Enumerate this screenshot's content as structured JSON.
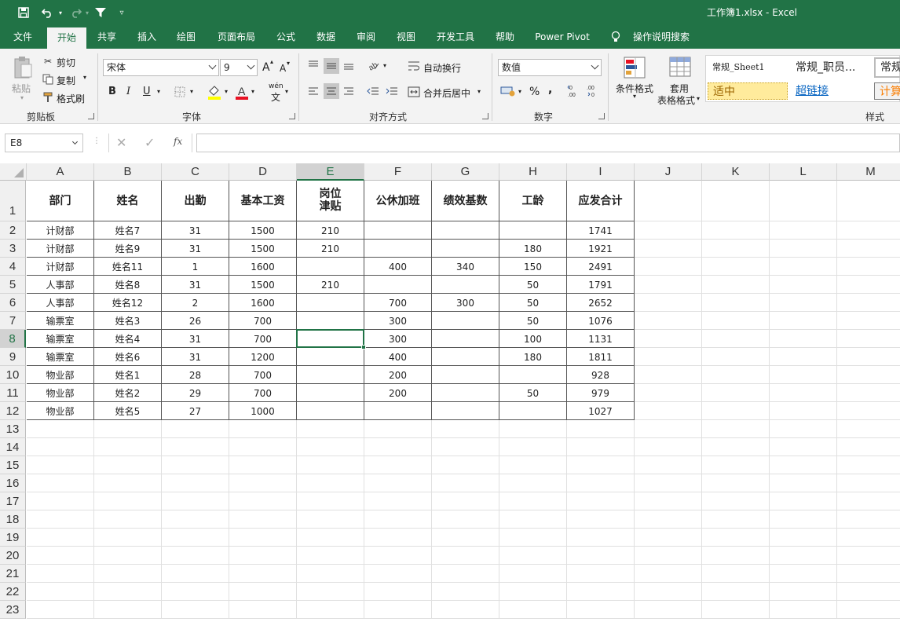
{
  "titlebar": {
    "title": "工作簿1.xlsx  -  Excel",
    "icons": [
      "save-icon",
      "undo-icon",
      "redo-icon",
      "filter-icon",
      "customize-qat-icon"
    ]
  },
  "tabs": [
    "文件",
    "开始",
    "共享",
    "插入",
    "绘图",
    "页面布局",
    "公式",
    "数据",
    "审阅",
    "视图",
    "开发工具",
    "帮助",
    "Power Pivot"
  ],
  "active_tab": "开始",
  "tell_me": "操作说明搜索",
  "ribbon": {
    "clipboard": {
      "paste": "粘贴",
      "cut": "剪切",
      "copy": "复制",
      "format_painter": "格式刷",
      "label": "剪贴板"
    },
    "font": {
      "name": "宋体",
      "size": "9",
      "label": "字体",
      "bold": "B",
      "italic": "I",
      "underline": "U",
      "grow": "A",
      "shrink": "A",
      "phonetic": "wén"
    },
    "alignment": {
      "wrap": "自动换行",
      "merge": "合并后居中",
      "label": "对齐方式"
    },
    "number": {
      "format": "数值",
      "label": "数字",
      "percent": "%",
      "comma": ","
    },
    "styles": {
      "conditional": "条件格式",
      "table_line1": "套用",
      "table_line2": "表格格式",
      "s1": "常规_Sheet1",
      "s2": "常规_职员...",
      "s3": "常规",
      "s4": "适中",
      "s5": "超链接",
      "s6": "计算",
      "label": "样式"
    }
  },
  "formula_bar": {
    "name_box": "E8",
    "fx": "fx",
    "content": ""
  },
  "grid": {
    "columns": [
      "A",
      "B",
      "C",
      "D",
      "E",
      "F",
      "G",
      "H",
      "I",
      "J",
      "K",
      "L",
      "M"
    ],
    "selected_col": "E",
    "selected_row": 8,
    "rows": [
      "1",
      "2",
      "3",
      "4",
      "5",
      "6",
      "7",
      "8",
      "9",
      "10",
      "11",
      "12",
      "13",
      "14",
      "15",
      "16",
      "17",
      "18",
      "19",
      "20",
      "21",
      "22",
      "23"
    ],
    "header_row": [
      "部门",
      "姓名",
      "出勤",
      "基本工资",
      "岗位\n津贴",
      "公休加班",
      "绩效基数",
      "工龄",
      "应发合计"
    ],
    "data": [
      [
        "计财部",
        "姓名7",
        "31",
        "1500",
        "210",
        "",
        "",
        "",
        "1741"
      ],
      [
        "计财部",
        "姓名9",
        "31",
        "1500",
        "210",
        "",
        "",
        "180",
        "1921"
      ],
      [
        "计财部",
        "姓名11",
        "1",
        "1600",
        "",
        "400",
        "340",
        "150",
        "2491"
      ],
      [
        "人事部",
        "姓名8",
        "31",
        "1500",
        "210",
        "",
        "",
        "50",
        "1791"
      ],
      [
        "人事部",
        "姓名12",
        "2",
        "1600",
        "",
        "700",
        "300",
        "50",
        "2652"
      ],
      [
        "输票室",
        "姓名3",
        "26",
        "700",
        "",
        "300",
        "",
        "50",
        "1076"
      ],
      [
        "输票室",
        "姓名4",
        "31",
        "700",
        "",
        "300",
        "",
        "100",
        "1131"
      ],
      [
        "输票室",
        "姓名6",
        "31",
        "1200",
        "",
        "400",
        "",
        "180",
        "1811"
      ],
      [
        "物业部",
        "姓名1",
        "28",
        "700",
        "",
        "200",
        "",
        "",
        "928"
      ],
      [
        "物业部",
        "姓名2",
        "29",
        "700",
        "",
        "200",
        "",
        "50",
        "979"
      ],
      [
        "物业部",
        "姓名5",
        "27",
        "1000",
        "",
        "",
        "",
        "",
        "1027"
      ]
    ]
  }
}
